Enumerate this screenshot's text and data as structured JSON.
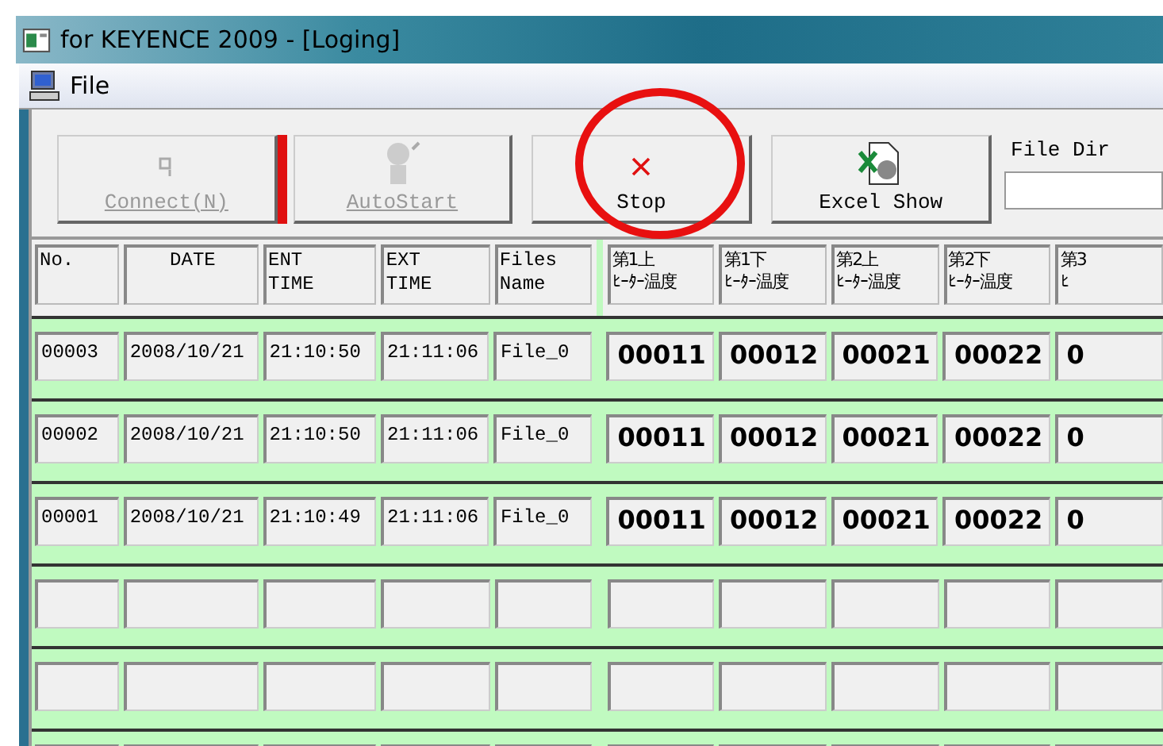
{
  "window": {
    "title": "for KEYENCE 2009 - [Loging]"
  },
  "menu": [
    {
      "label": "File"
    }
  ],
  "toolbar": {
    "buttons": [
      {
        "kind": "connect",
        "label": "Connect(N)",
        "disabled": true
      },
      {
        "kind": "autostart",
        "label": "AutoStart",
        "disabled": true
      },
      {
        "kind": "stop",
        "label": "Stop",
        "disabled": false
      },
      {
        "kind": "excel",
        "label": "Excel Show",
        "disabled": false
      }
    ],
    "file_dir": {
      "label": "File Dir"
    }
  },
  "table": {
    "columns": [
      {
        "lines": [
          "No."
        ],
        "kind": "info"
      },
      {
        "lines": [
          "DATE"
        ],
        "kind": "info"
      },
      {
        "lines": [
          "ENT",
          "TIME"
        ],
        "kind": "info"
      },
      {
        "lines": [
          "EXT",
          "TIME"
        ],
        "kind": "info"
      },
      {
        "lines": [
          "Files",
          "Name"
        ],
        "kind": "info"
      },
      {
        "lines": [
          "第1上",
          "ﾋｰﾀｰ温度"
        ],
        "kind": "temp"
      },
      {
        "lines": [
          "第1下",
          "ﾋｰﾀｰ温度"
        ],
        "kind": "temp"
      },
      {
        "lines": [
          "第2上",
          "ﾋｰﾀｰ温度"
        ],
        "kind": "temp"
      },
      {
        "lines": [
          "第2下",
          "ﾋｰﾀｰ温度"
        ],
        "kind": "temp"
      },
      {
        "lines": [
          "第3",
          "ﾋ"
        ],
        "kind": "temp"
      }
    ],
    "rows": [
      {
        "cells": [
          "00003",
          "2008/10/21",
          "21:10:50",
          "21:11:06",
          "File_0",
          "00011",
          "00012",
          "00021",
          "00022",
          "0"
        ]
      },
      {
        "cells": [
          "00002",
          "2008/10/21",
          "21:10:50",
          "21:11:06",
          "File_0",
          "00011",
          "00012",
          "00021",
          "00022",
          "0"
        ]
      },
      {
        "cells": [
          "00001",
          "2008/10/21",
          "21:10:49",
          "21:11:06",
          "File_0",
          "00011",
          "00012",
          "00021",
          "00022",
          "0"
        ]
      }
    ]
  }
}
